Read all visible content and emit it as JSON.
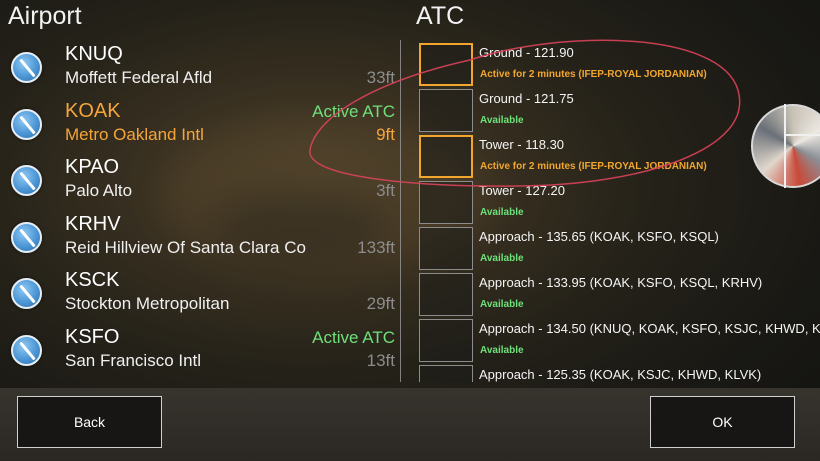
{
  "headers": {
    "airport": "Airport",
    "atc": "ATC"
  },
  "airports": [
    {
      "code": "KNUQ",
      "name": "Moffett Federal Afld",
      "atc": "",
      "elevation": "33ft",
      "selected": false
    },
    {
      "code": "KOAK",
      "name": "Metro Oakland Intl",
      "atc": "Active ATC",
      "elevation": "9ft",
      "selected": true
    },
    {
      "code": "KPAO",
      "name": "Palo Alto",
      "atc": "",
      "elevation": "3ft",
      "selected": false
    },
    {
      "code": "KRHV",
      "name": "Reid Hillview Of Santa Clara Co",
      "atc": "",
      "elevation": "133ft",
      "selected": false
    },
    {
      "code": "KSCK",
      "name": "Stockton Metropolitan",
      "atc": "",
      "elevation": "29ft",
      "selected": false
    },
    {
      "code": "KSFO",
      "name": "San Francisco Intl",
      "atc": "Active ATC",
      "elevation": "13ft",
      "selected": false
    }
  ],
  "atc": [
    {
      "frequency": "Ground - 121.90",
      "status": "Active for 2 minutes (IFEP-ROYAL JORDANIAN)",
      "active": true
    },
    {
      "frequency": "Ground - 121.75",
      "status": "Available",
      "active": false
    },
    {
      "frequency": "Tower - 118.30",
      "status": "Active for 2 minutes (IFEP-ROYAL JORDANIAN)",
      "active": true
    },
    {
      "frequency": "Tower - 127.20",
      "status": "Available",
      "active": false
    },
    {
      "frequency": "Approach - 135.65 (KOAK, KSFO, KSQL)",
      "status": "Available",
      "active": false
    },
    {
      "frequency": "Approach - 133.95 (KOAK, KSFO, KSQL, KRHV)",
      "status": "Available",
      "active": false
    },
    {
      "frequency": "Approach - 134.50 (KNUQ, KOAK, KSFO, KSJC, KHWD, K...",
      "status": "Available",
      "active": false
    },
    {
      "frequency": "Approach - 125.35 (KOAK, KSJC, KHWD, KLVK)",
      "status": "",
      "active": false
    }
  ],
  "buttons": {
    "back": "Back",
    "ok": "OK"
  },
  "icons": {
    "airport": "airport-compass-icon"
  },
  "colors": {
    "selected": "#f5a53a",
    "active_atc": "#6ee07a",
    "busy": "#f2a62e",
    "annotation": "#d9425a"
  }
}
